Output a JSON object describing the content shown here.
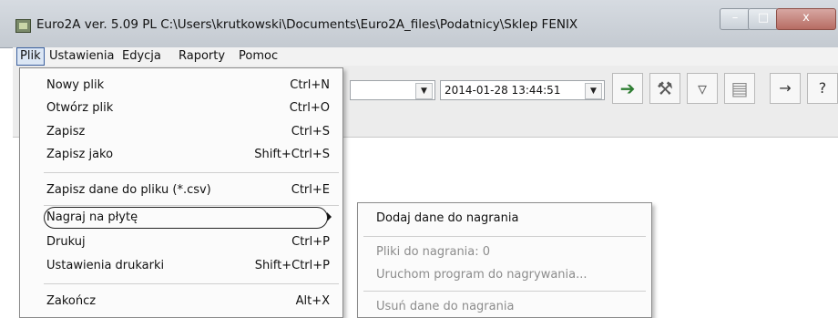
{
  "window": {
    "title": "Euro2A ver. 5.09 PL   C:\\Users\\krutkowski\\Documents\\Euro2A_files\\Podatnicy\\Sklep FENIX",
    "controls": {
      "close_label": "x"
    }
  },
  "menubar": {
    "items": [
      {
        "label": "Plik"
      },
      {
        "label": "Ustawienia"
      },
      {
        "label": "Edycja"
      },
      {
        "label": "Raporty"
      },
      {
        "label": "Pomoc"
      }
    ]
  },
  "toolbar": {
    "date_value": "2014-01-28 13:44:51",
    "icons": [
      "import-icon",
      "tools-icon",
      "filter-icon",
      "document-icon",
      "usb-icon",
      "help-icon"
    ]
  },
  "file_menu": {
    "items": [
      {
        "label": "Nowy plik",
        "shortcut": "Ctrl+N"
      },
      {
        "label": "Otwórz plik",
        "shortcut": "Ctrl+O"
      },
      {
        "label": "Zapisz",
        "shortcut": "Ctrl+S"
      },
      {
        "label": "Zapisz jako",
        "shortcut": "Shift+Ctrl+S"
      },
      {
        "label": "Zapisz dane do pliku (*.csv)",
        "shortcut": "Ctrl+E"
      },
      {
        "label": "Nagraj na płytę",
        "shortcut": ""
      },
      {
        "label": "Drukuj",
        "shortcut": "Ctrl+P"
      },
      {
        "label": "Ustawienia drukarki",
        "shortcut": "Shift+Ctrl+P"
      },
      {
        "label": "Zakończ",
        "shortcut": "Alt+X"
      }
    ]
  },
  "submenu": {
    "items": [
      {
        "label": "Dodaj dane do nagrania",
        "enabled": true
      },
      {
        "label": "Pliki do nagrania: 0",
        "enabled": false
      },
      {
        "label": "Uruchom program do nagrywania...",
        "enabled": false
      },
      {
        "label": "Usuń dane do nagrania",
        "enabled": false
      }
    ]
  }
}
